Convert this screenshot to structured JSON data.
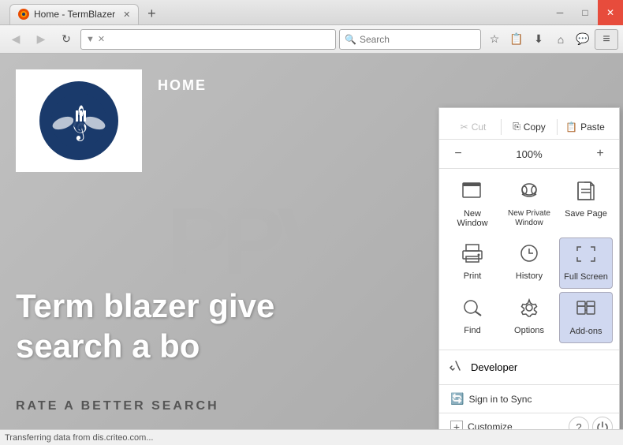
{
  "browser": {
    "title": "Home - TermBlazer",
    "tab": {
      "title": "Home - TermBlazer",
      "favicon": "🦊"
    },
    "controls": {
      "minimize": "─",
      "maximize": "□",
      "close": "✕"
    },
    "nav": {
      "back": "◀",
      "forward": "▶",
      "refresh": "↻",
      "search_placeholder": "Search"
    },
    "toolbar": {
      "star": "☆",
      "bookmark": "📋",
      "download": "⬇",
      "home": "⌂",
      "chat": "💬",
      "menu": "≡"
    }
  },
  "page": {
    "heading": "HOME",
    "tagline_line1": "Term blazer give",
    "tagline_line2": "search a bo",
    "bottom_text": "RATE A BETTER SEARCH",
    "watermark": "PPV",
    "logo_icon": "𝄟"
  },
  "status_bar": {
    "text": "Transferring data from dis.criteo.com..."
  },
  "menu": {
    "cut_label": "Cut",
    "copy_label": "Copy",
    "paste_label": "Paste",
    "zoom_minus": "−",
    "zoom_value": "100%",
    "zoom_plus": "+",
    "items": [
      {
        "id": "new-window",
        "icon": "🗔",
        "label": "New Window"
      },
      {
        "id": "new-private",
        "icon": "🕵",
        "label": "New Private\nWindow"
      },
      {
        "id": "save-page",
        "icon": "📄",
        "label": "Save Page"
      },
      {
        "id": "print",
        "icon": "🖨",
        "label": "Print"
      },
      {
        "id": "history",
        "icon": "🕐",
        "label": "History"
      },
      {
        "id": "full-screen",
        "icon": "⛶",
        "label": "Full Screen"
      },
      {
        "id": "find",
        "icon": "🔍",
        "label": "Find"
      },
      {
        "id": "options",
        "icon": "⚙",
        "label": "Options"
      },
      {
        "id": "add-ons",
        "icon": "🧩",
        "label": "Add-ons"
      }
    ],
    "developer_icon": "🔧",
    "developer_label": "Developer",
    "sign_in_icon": "🔄",
    "sign_in_label": "Sign in to Sync",
    "customize_icon": "✚",
    "customize_label": "Customize",
    "help_icon": "?",
    "power_icon": "⏻"
  }
}
